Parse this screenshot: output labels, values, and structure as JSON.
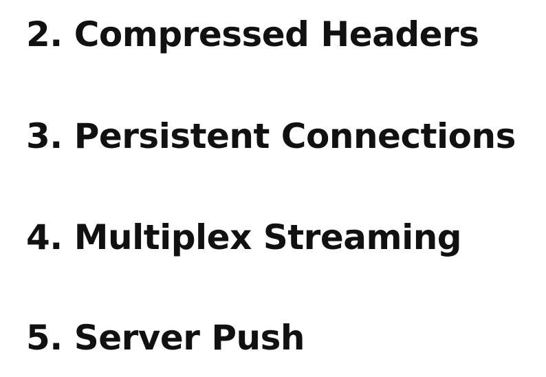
{
  "items": [
    {
      "number": "2.",
      "text": "Compressed Headers"
    },
    {
      "number": "3.",
      "text": "Persistent Connections"
    },
    {
      "number": "4.",
      "text": "Multiplex Streaming"
    },
    {
      "number": "5.",
      "text": "Server Push"
    }
  ],
  "colors": {
    "text": "#111111",
    "background": "#ffffff"
  }
}
